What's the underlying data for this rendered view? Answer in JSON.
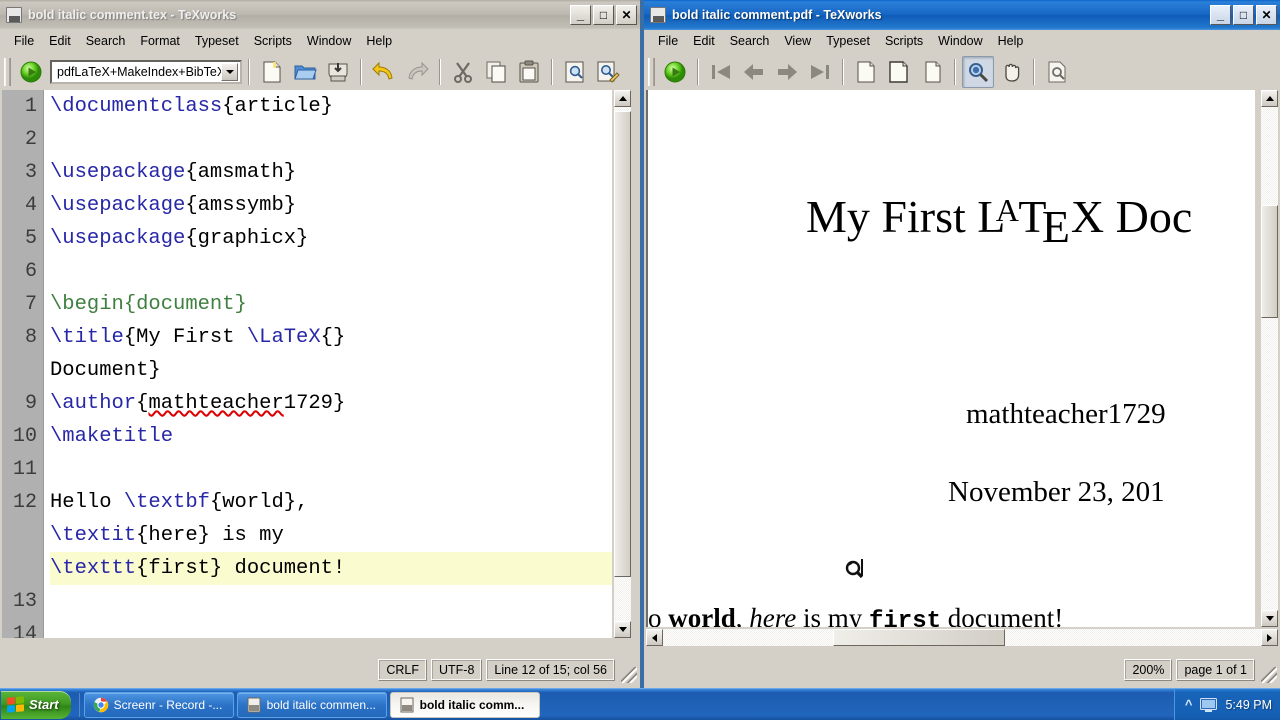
{
  "desktop": {
    "background_color": "#3a6ea5"
  },
  "editor_window": {
    "title": "bold italic comment.tex - TeXworks",
    "icon": "texworks-tex-icon",
    "active": false,
    "window_buttons": {
      "minimize": "_",
      "maximize": "□",
      "close": "✕"
    },
    "menus": [
      "File",
      "Edit",
      "Search",
      "Format",
      "Typeset",
      "Scripts",
      "Window",
      "Help"
    ],
    "toolbar": {
      "typeset_button": "typeset-run-icon",
      "typeset_engine": "pdfLaTeX+MakeIndex+BibTeX",
      "buttons": [
        "new-document-icon",
        "open-folder-icon",
        "save-icon",
        "undo-icon",
        "redo-icon",
        "cut-scissors-icon",
        "copy-icon",
        "paste-icon",
        "find-icon",
        "replace-icon"
      ]
    },
    "gutter_numbers": [
      "1",
      "2",
      "3",
      "4",
      "5",
      "6",
      "7",
      "8",
      "",
      "9",
      "10",
      "11",
      "12",
      "",
      "",
      "13",
      "14"
    ],
    "lines": [
      {
        "num": "1",
        "highlight": false,
        "tokens": [
          {
            "t": "\\documentclass",
            "c": "cmd"
          },
          {
            "t": "{article}",
            "c": "plain"
          }
        ]
      },
      {
        "num": "2",
        "highlight": false,
        "tokens": []
      },
      {
        "num": "3",
        "highlight": false,
        "tokens": [
          {
            "t": "\\usepackage",
            "c": "cmd"
          },
          {
            "t": "{amsmath}",
            "c": "plain"
          }
        ]
      },
      {
        "num": "4",
        "highlight": false,
        "tokens": [
          {
            "t": "\\usepackage",
            "c": "cmd"
          },
          {
            "t": "{amssymb}",
            "c": "plain"
          }
        ]
      },
      {
        "num": "5",
        "highlight": false,
        "tokens": [
          {
            "t": "\\usepackage",
            "c": "cmd"
          },
          {
            "t": "{graphicx}",
            "c": "plain"
          }
        ]
      },
      {
        "num": "6",
        "highlight": false,
        "tokens": []
      },
      {
        "num": "7",
        "highlight": false,
        "tokens": [
          {
            "t": "\\begin",
            "c": "env"
          },
          {
            "t": "{document}",
            "c": "env"
          }
        ]
      },
      {
        "num": "8",
        "highlight": false,
        "tokens": [
          {
            "t": "\\title",
            "c": "cmd"
          },
          {
            "t": "{My First ",
            "c": "plain"
          },
          {
            "t": "\\LaTeX",
            "c": "cmd"
          },
          {
            "t": "{}",
            "c": "plain"
          }
        ]
      },
      {
        "num": "",
        "highlight": false,
        "tokens": [
          {
            "t": "Document}",
            "c": "plain"
          }
        ]
      },
      {
        "num": "9",
        "highlight": false,
        "tokens": [
          {
            "t": "\\author",
            "c": "cmd"
          },
          {
            "t": "{",
            "c": "plain"
          },
          {
            "t": "mathteacher",
            "c": "sp"
          },
          {
            "t": "1729}",
            "c": "plain"
          }
        ]
      },
      {
        "num": "10",
        "highlight": false,
        "tokens": [
          {
            "t": "\\maketitle",
            "c": "cmd"
          }
        ]
      },
      {
        "num": "11",
        "highlight": false,
        "tokens": []
      },
      {
        "num": "12",
        "highlight": false,
        "tokens": [
          {
            "t": "Hello ",
            "c": "plain"
          },
          {
            "t": "\\textbf",
            "c": "cmd"
          },
          {
            "t": "{world},",
            "c": "plain"
          }
        ]
      },
      {
        "num": "",
        "highlight": false,
        "tokens": [
          {
            "t": "\\textit",
            "c": "cmd"
          },
          {
            "t": "{here} is my",
            "c": "plain"
          }
        ]
      },
      {
        "num": "",
        "highlight": true,
        "tokens": [
          {
            "t": "\\texttt",
            "c": "cmd"
          },
          {
            "t": "{first} document!",
            "c": "plain"
          }
        ]
      },
      {
        "num": "13",
        "highlight": false,
        "tokens": []
      },
      {
        "num": "14",
        "highlight": false,
        "tokens": []
      }
    ],
    "statusbar": {
      "line_ending": "CRLF",
      "encoding": "UTF-8",
      "position": "Line 12 of 15; col 56"
    }
  },
  "pdf_window": {
    "title": "bold italic comment.pdf - TeXworks",
    "icon": "texworks-pdf-icon",
    "active": true,
    "window_buttons": {
      "minimize": "_",
      "maximize": "□",
      "close": "✕"
    },
    "menus": [
      "File",
      "Edit",
      "Search",
      "View",
      "Typeset",
      "Scripts",
      "Window",
      "Help"
    ],
    "toolbar": {
      "buttons": [
        "typeset-run-icon",
        "first-page-icon",
        "previous-page-icon",
        "next-page-icon",
        "last-page-icon",
        "fit-page-icon",
        "fit-width-icon",
        "actual-size-icon",
        "magnify-tool-icon",
        "hand-tool-icon",
        "search-page-icon"
      ],
      "active_tool": "magnify-tool-icon"
    },
    "page": {
      "title_text": "My First ",
      "title_latex": {
        "l": "L",
        "a": "A",
        "t": "T",
        "e": "E",
        "x": "X"
      },
      "title_tail": " Doc",
      "author": "mathteacher1729",
      "date": "November 23, 201",
      "body": {
        "pre": "o ",
        "bold": "world",
        "mid1": ", ",
        "italic": "here",
        "mid2": " is my ",
        "mono": "first",
        "tail": " document!"
      },
      "cursor": "magnifier-cursor"
    },
    "statusbar": {
      "zoom": "200%",
      "page_indicator": "page 1 of 1"
    }
  },
  "taskbar": {
    "start_label": "Start",
    "items": [
      {
        "label": "Screenr - Record -...",
        "icon": "chrome-icon",
        "active": false
      },
      {
        "label": "bold italic commen...",
        "icon": "texworks-tex-icon",
        "active": false
      },
      {
        "label": "bold italic comm...",
        "icon": "texworks-pdf-icon",
        "active": true
      }
    ],
    "tray": {
      "show_hidden": "show-hidden-icons-chevron",
      "clock": "5:49 PM",
      "icons": [
        "display-icon"
      ]
    }
  },
  "colors": {
    "title_active": "#1667c4",
    "title_inactive": "#bcb8b0",
    "chrome": "#d4d0c8",
    "command_blue": "#2727a8",
    "env_green": "#3f7f3f",
    "current_line": "#fbfbd0",
    "spellcheck_red": "#dd0000",
    "desktop": "#3a6ea5"
  }
}
